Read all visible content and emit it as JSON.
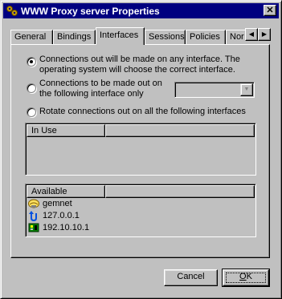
{
  "window": {
    "title": "WWW Proxy server Properties",
    "close_glyph": "✕",
    "title_icon": "gears-icon"
  },
  "tabs": [
    {
      "label": "General",
      "active": false
    },
    {
      "label": "Bindings",
      "active": false
    },
    {
      "label": "Interfaces",
      "active": true
    },
    {
      "label": "Sessions",
      "active": false
    },
    {
      "label": "Policies",
      "active": false
    },
    {
      "label": "Nor",
      "active": false
    }
  ],
  "tab_scroll": {
    "left_glyph": "◀",
    "right_glyph": "▶"
  },
  "options": {
    "any_interface": {
      "line1": "Connections out will be made on any interface.  The",
      "line2": "operating system will choose the correct interface.",
      "checked": true
    },
    "following_interface": {
      "line1": "Connections to be made out on",
      "line2": "the following interface only",
      "checked": false,
      "combo_value": ""
    },
    "rotate": {
      "label": "Rotate connections out on all the following interfaces",
      "checked": false
    }
  },
  "in_use": {
    "header": "In Use",
    "items": []
  },
  "available": {
    "header": "Available",
    "items": [
      {
        "label": "gemnet",
        "icon": "network-hands-icon"
      },
      {
        "label": "127.0.0.1",
        "icon": "loopback-icon"
      },
      {
        "label": "192.10.10.1",
        "icon": "network-card-icon"
      }
    ]
  },
  "buttons": {
    "cancel": "Cancel",
    "ok_underlined": "O",
    "ok_rest": "K"
  },
  "colors": {
    "titlebar": "#000080",
    "face": "#c0c0c0"
  }
}
